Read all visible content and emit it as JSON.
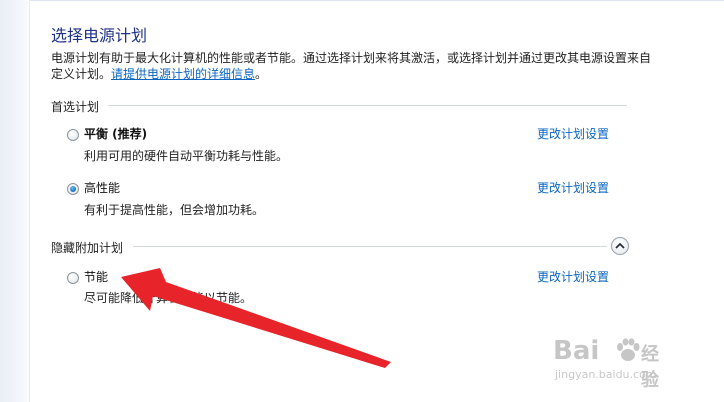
{
  "header": {
    "title": "选择电源计划"
  },
  "intro": {
    "text": "电源计划有助于最大化计算机的性能或者节能。通过选择计划来将其激活，或选择计划并通过更改其电源设置来自定义计划。",
    "link": "请提供电源计划的详细信息",
    "trailing": "。"
  },
  "preferred_section": {
    "label": "首选计划",
    "plans": [
      {
        "name": "平衡 (推荐)",
        "desc": "利用可用的硬件自动平衡功耗与性能。",
        "selected": false,
        "link": "更改计划设置"
      },
      {
        "name": "高性能",
        "desc": "有利于提高性能，但会增加功耗。",
        "selected": true,
        "link": "更改计划设置"
      }
    ]
  },
  "hidden_section": {
    "label": "隐藏附加计划",
    "plans": [
      {
        "name": "节能",
        "desc": "尽可能降低计算机性能以节能。",
        "selected": false,
        "link": "更改计划设置"
      }
    ]
  },
  "watermark": {
    "logo": "Bai",
    "logo_cn": "经验",
    "url": "jingyan.baidu.com"
  },
  "colors": {
    "title": "#1e3287",
    "link": "#0b66c2",
    "annotation_arrow": "#e8242b"
  }
}
